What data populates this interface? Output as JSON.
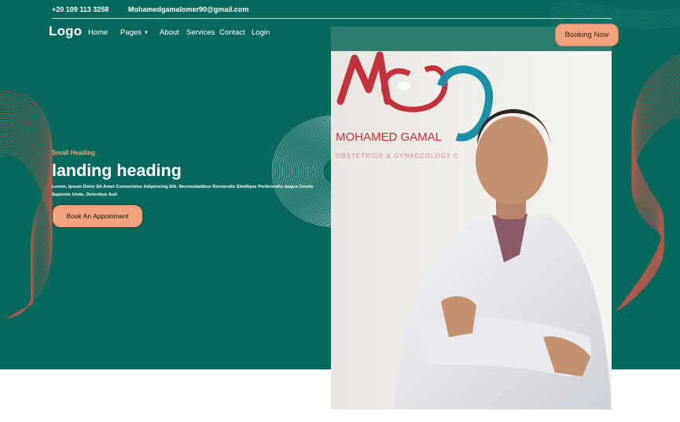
{
  "topbar": {
    "phone": "+20 109 113 3258",
    "email": "Mohamedgamalomer90@gmail.com"
  },
  "logo": "Logo",
  "nav": {
    "items": [
      {
        "label": "Home"
      },
      {
        "label": "Pages",
        "has_dropdown": true
      },
      {
        "label": "About"
      },
      {
        "label": "Services"
      },
      {
        "label": "Contact"
      },
      {
        "label": "Login"
      }
    ],
    "dropdown_caret": "▼"
  },
  "booking_button": "Booking Now",
  "hero": {
    "small_heading": "Small Heading",
    "heading": "landing heading",
    "description": "Lorem, Ipsum Dolor Sit Amet Consectetur Adipisicing Elit. Necessitatibus Reiciendis Similique Perferendis Itaque Omnis Sapiente Unde, Doloribus Aut!",
    "cta_button": "Book An Appoinment"
  },
  "photo": {
    "sign_text": "MOHAMED GAMAL",
    "sign_subtitle": "OBSTETRICS & GYNAECOLOGY C"
  },
  "colors": {
    "hero_background": "#06695c",
    "accent": "#f0a37c",
    "decor_lines": "#e0564a"
  }
}
